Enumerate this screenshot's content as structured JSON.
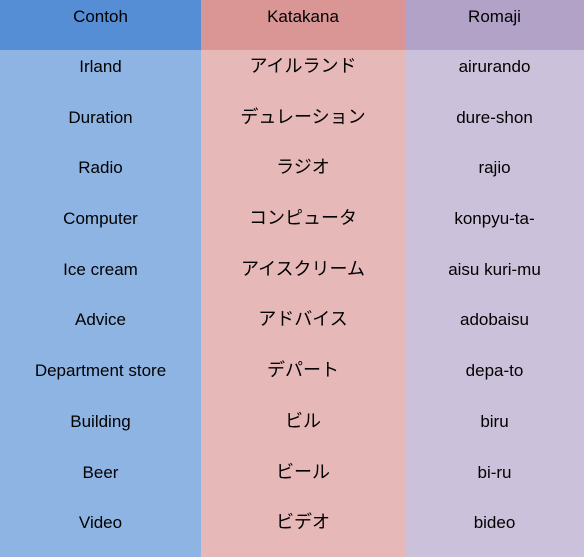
{
  "headers": [
    "Contoh",
    "Katakana",
    "Romaji"
  ],
  "rows": [
    [
      "Irland",
      "アイルランド",
      "airurando"
    ],
    [
      "Duration",
      "デュレーション",
      "dure-shon"
    ],
    [
      "Radio",
      "ラジオ",
      "rajio"
    ],
    [
      "Computer",
      "コンピュータ",
      "konpyu-ta-"
    ],
    [
      "Ice cream",
      "アイスクリーム",
      "aisu kuri-mu"
    ],
    [
      "Advice",
      "アドバイス",
      "adobaisu"
    ],
    [
      "Department store",
      "デパート",
      "depa-to"
    ],
    [
      "Building",
      "ビル",
      "biru"
    ],
    [
      "Beer",
      "ビール",
      "bi-ru"
    ],
    [
      "Video",
      "ビデオ",
      "bideo"
    ]
  ],
  "colors": {
    "header": [
      "#558ed5",
      "#d99694",
      "#b2a2c7"
    ],
    "body": [
      "#8eb4e3",
      "#e6b9b8",
      "#ccc1da"
    ]
  }
}
